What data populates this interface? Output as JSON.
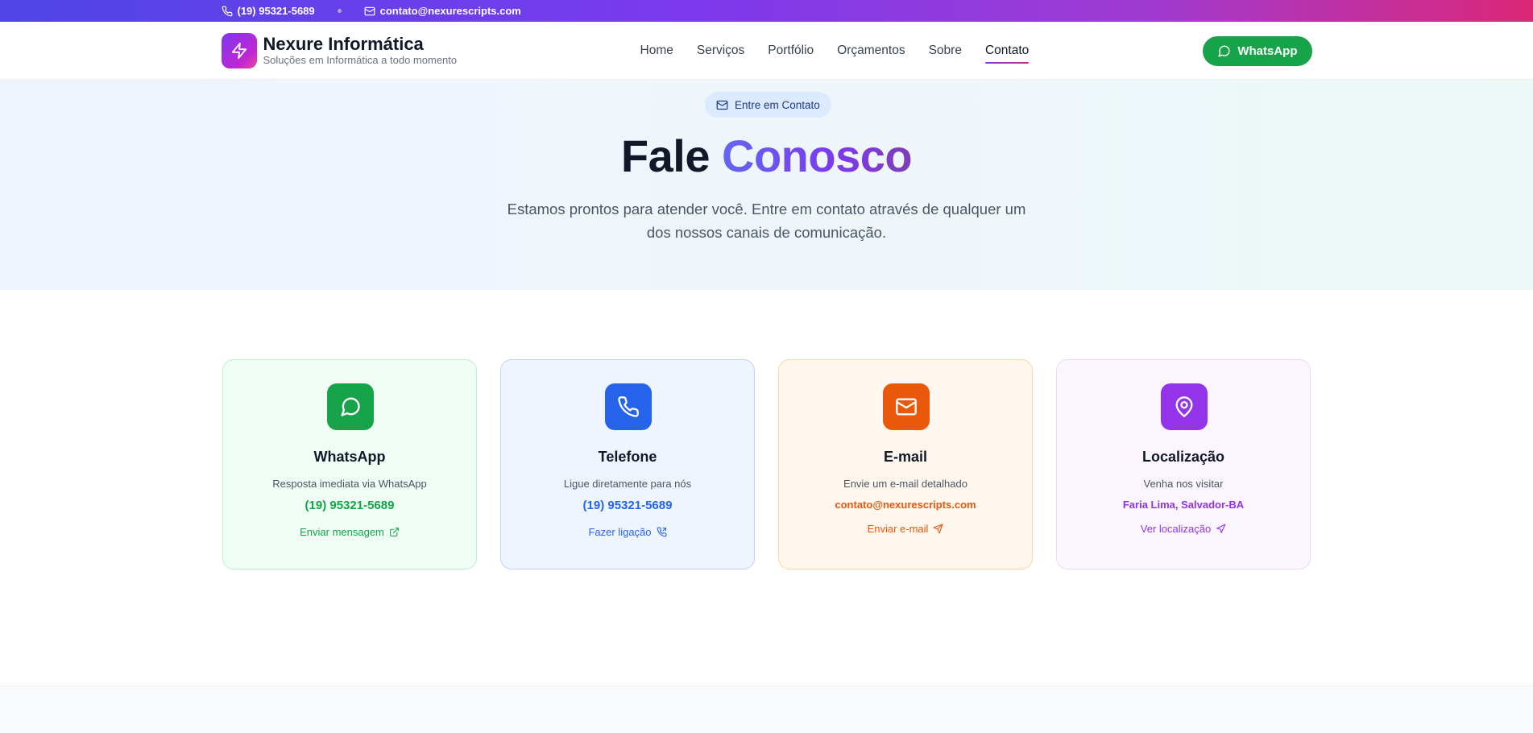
{
  "topbar": {
    "phone": "(19) 95321-5689",
    "email": "contato@nexurescripts.com"
  },
  "header": {
    "brand_name": "Nexure Informática",
    "brand_tagline": "Soluções em Informática a todo momento",
    "nav": [
      "Home",
      "Serviços",
      "Portfólio",
      "Orçamentos",
      "Sobre",
      "Contato"
    ],
    "active_nav": "Contato",
    "whatsapp_button": "WhatsApp"
  },
  "hero": {
    "badge": "Entre em Contato",
    "title_part1": "Fale",
    "title_part2": "Conosco",
    "subtitle_line1": "Estamos prontos para atender você. Entre em contato através de qualquer um",
    "subtitle_line2": "dos nossos canais de comunicação."
  },
  "cards": [
    {
      "title": "WhatsApp",
      "desc": "Resposta imediata via WhatsApp",
      "value": "(19) 95321-5689",
      "action": "Enviar mensagem",
      "icon": "chat-bubble-icon",
      "action_icon": "external-link-icon",
      "color": "#16a34a"
    },
    {
      "title": "Telefone",
      "desc": "Ligue diretamente para nós",
      "value": "(19) 95321-5689",
      "action": "Fazer ligação",
      "icon": "phone-icon",
      "action_icon": "phone-call-icon",
      "color": "#2563eb"
    },
    {
      "title": "E-mail",
      "desc": "Envie um e-mail detalhado",
      "value": "contato@nexurescripts.com",
      "action": "Enviar e-mail",
      "icon": "mail-icon",
      "action_icon": "send-icon",
      "color": "#ea580c"
    },
    {
      "title": "Localização",
      "desc": "Venha nos visitar",
      "value": "Faria Lima, Salvador-BA",
      "action": "Ver localização",
      "icon": "map-pin-icon",
      "action_icon": "navigation-icon",
      "color": "#9333ea"
    }
  ]
}
